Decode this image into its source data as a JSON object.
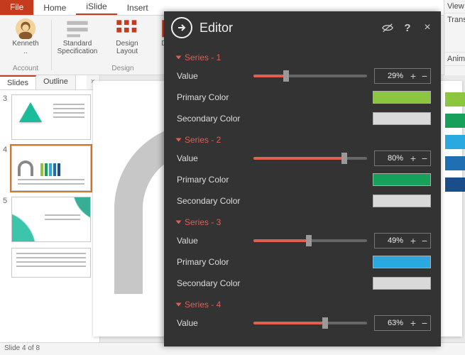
{
  "ribbon": {
    "file": "File",
    "tabs": [
      "Home",
      "iSlide",
      "Insert"
    ],
    "active": "iSlide",
    "right_tabs": [
      "View",
      "Transit",
      "Anim"
    ],
    "account": {
      "name": "Kenneth\n..",
      "group": "Account"
    },
    "design_group": "Design",
    "btns": {
      "spec": "Standard\nSpecification",
      "layout": "Design\nLayout",
      "tools": "Design\nTools"
    }
  },
  "panes": {
    "slides": "Slides",
    "outline": "Outline"
  },
  "thumbs": [
    {
      "n": "3"
    },
    {
      "n": "4"
    },
    {
      "n": "5"
    },
    {
      "n": ""
    }
  ],
  "status": "Slide 4 of 8",
  "panel": {
    "title": "Editor",
    "series_label_prefix": "Series",
    "value_label": "Value",
    "primary_label": "Primary Color",
    "secondary_label": "Secondary Color"
  },
  "series": [
    {
      "idx": "1",
      "value": 29,
      "display": "29%",
      "primary": "#8cc63f",
      "secondary": "#d9d9d9"
    },
    {
      "idx": "2",
      "value": 80,
      "display": "80%",
      "primary": "#17a05a",
      "secondary": "#d9d9d9"
    },
    {
      "idx": "3",
      "value": 49,
      "display": "49%",
      "primary": "#2aa9e0",
      "secondary": "#d9d9d9"
    },
    {
      "idx": "4",
      "value": 63,
      "display": "63%",
      "primary": "#1f6fb2",
      "secondary": "#d9d9d9"
    }
  ],
  "chips": [
    "#8cc63f",
    "#17a05a",
    "#2aa9e0",
    "#1f6fb2",
    "#1a4e8a"
  ]
}
